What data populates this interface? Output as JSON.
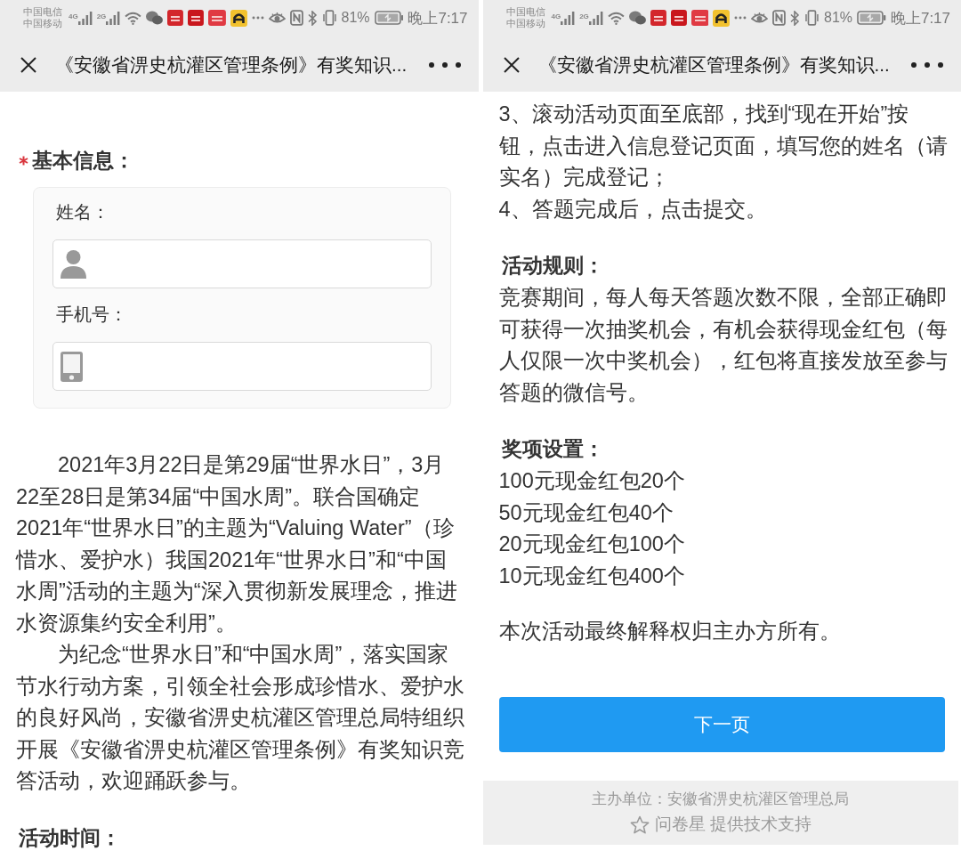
{
  "panels": [
    {
      "status_bar": {
        "carriers": [
          "中国电信",
          "中国移动"
        ],
        "networks": [
          "4G",
          "2G"
        ],
        "battery": "81%",
        "time": "晚上7:17"
      },
      "nav": {
        "title": "《安徽省淠史杭灌区管理条例》有奖知识..."
      },
      "sections": [
        [
          {
            "kind": "heading",
            "text": "基本信息：",
            "required": true
          },
          {
            "kind": "form",
            "fields": [
              {
                "kind": "name",
                "label": "姓名："
              },
              {
                "kind": "phone",
                "label": "手机号："
              }
            ]
          }
        ],
        [
          {
            "kind": "paragraph",
            "text": "2021年3月22日是第29届“世界水日”，3月22至28日是第34届“中国水周”。联合国确定2021年“世界水日”的主题为“Valuing Water”（珍惜水、爱护水）我国2021年“世界水日”和“中国水周”活动的主题为“深入贯彻新发展理念，推进水资源集约安全利用”。"
          },
          {
            "kind": "paragraph",
            "text": "为纪念“世界水日”和“中国水周”，落实国家节水行动方案，引领全社会形成珍惜水、爱护水的良好风尚，安徽省淠史杭灌区管理总局特组织开展《安徽省淠史杭灌区管理条例》有奖知识竞答活动，欢迎踊跃参与。"
          }
        ],
        [
          {
            "kind": "heading",
            "text": "活动时间：",
            "required": false
          }
        ]
      ]
    },
    {
      "status_bar": {
        "carriers": [
          "中国电信",
          "中国移动"
        ],
        "networks": [
          "4G",
          "2G"
        ],
        "battery": "81%",
        "time": "晚上7:17"
      },
      "nav": {
        "title": "《安徽省淠史杭灌区管理条例》有奖知识..."
      },
      "sections": [
        [
          {
            "kind": "text",
            "text": "3、滚动活动页面至底部，找到“现在开始”按钮，点击进入信息登记页面，填写您的姓名（请实名）完成登记；"
          },
          {
            "kind": "text",
            "text": "4、答题完成后，点击提交。"
          }
        ],
        [
          {
            "kind": "heading",
            "text": "活动规则：",
            "required": false
          },
          {
            "kind": "text",
            "text": "竞赛期间，每人每天答题次数不限，全部正确即可获得一次抽奖机会，有机会获得现金红包（每人仅限一次中奖机会），红包将直接发放至参与答题的微信号。"
          }
        ],
        [
          {
            "kind": "heading",
            "text": "奖项设置：",
            "required": false
          },
          {
            "kind": "text",
            "text": "100元现金红包20个"
          },
          {
            "kind": "text",
            "text": "50元现金红包40个"
          },
          {
            "kind": "text",
            "text": "20元现金红包100个"
          },
          {
            "kind": "text",
            "text": "10元现金红包400个"
          }
        ],
        [
          {
            "kind": "text",
            "text": "本次活动最终解释权归主办方所有。"
          }
        ],
        [
          {
            "kind": "button",
            "text": "下一页"
          }
        ]
      ],
      "footer": {
        "organizer": "主办单位：安徽省淠史杭灌区管理总局",
        "support": "问卷星 提供技术支持"
      }
    }
  ]
}
